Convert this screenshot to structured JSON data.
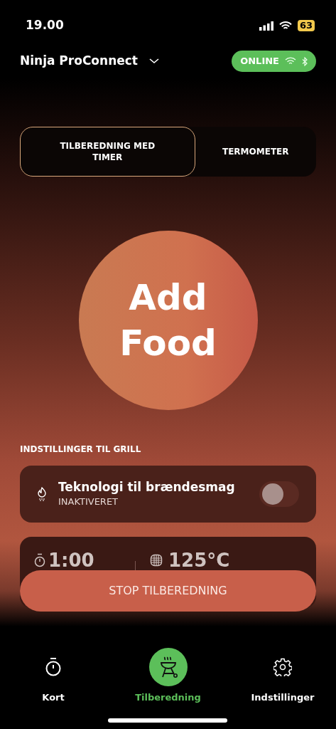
{
  "status_bar": {
    "time": "19.00",
    "battery": "63"
  },
  "header": {
    "title": "Ninja ProConnect",
    "connection": {
      "label": "ONLINE",
      "online": true
    }
  },
  "mode_tabs": [
    {
      "label": "TILBEREDNING MED TIMER",
      "selected": true
    },
    {
      "label": "TERMOMETER",
      "selected": false
    }
  ],
  "add_food": {
    "label": "Add Food"
  },
  "section_title": "INDSTILLINGER TIL GRILL",
  "smoke_setting": {
    "title": "Teknologi til brændesmag",
    "status": "INAKTIVERET",
    "on": false
  },
  "cook_settings": {
    "time": "1:00",
    "temperature": "125°C"
  },
  "stop_button": "STOP TILBEREDNING",
  "bottom_nav": [
    {
      "label": "Kort",
      "kind": "timer",
      "selected": false
    },
    {
      "label": "Tilberedning",
      "kind": "grill",
      "selected": true
    },
    {
      "label": "Indstillinger",
      "kind": "gear",
      "selected": false
    }
  ]
}
